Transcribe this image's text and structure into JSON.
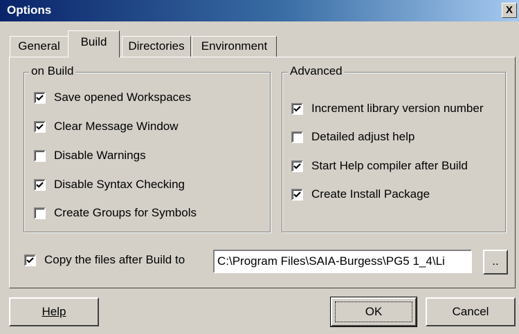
{
  "window": {
    "title": "Options",
    "close_glyph": "X"
  },
  "tabs": [
    {
      "label": "General",
      "active": false
    },
    {
      "label": "Build",
      "active": true
    },
    {
      "label": "Directories",
      "active": false
    },
    {
      "label": "Environment",
      "active": false
    }
  ],
  "on_build": {
    "label": "on Build",
    "items": [
      {
        "label": "Save opened Workspaces",
        "checked": true
      },
      {
        "label": "Clear Message Window",
        "checked": true
      },
      {
        "label": "Disable Warnings",
        "checked": false
      },
      {
        "label": "Disable Syntax Checking",
        "checked": true
      },
      {
        "label": "Create Groups for Symbols",
        "checked": false
      }
    ]
  },
  "advanced": {
    "label": "Advanced",
    "items": [
      {
        "label": "Increment library version number",
        "checked": true
      },
      {
        "label": "Detailed adjust help",
        "checked": false
      },
      {
        "label": "Start Help compiler after Build",
        "checked": true
      },
      {
        "label": "Create Install Package",
        "checked": true
      }
    ]
  },
  "copy": {
    "label": "Copy the files after Build to",
    "checked": true,
    "path": "C:\\Program Files\\SAIA-Burgess\\PG5 1_4\\Li",
    "browse_label": ".."
  },
  "buttons": {
    "help": "Help",
    "ok": "OK",
    "cancel": "Cancel"
  }
}
